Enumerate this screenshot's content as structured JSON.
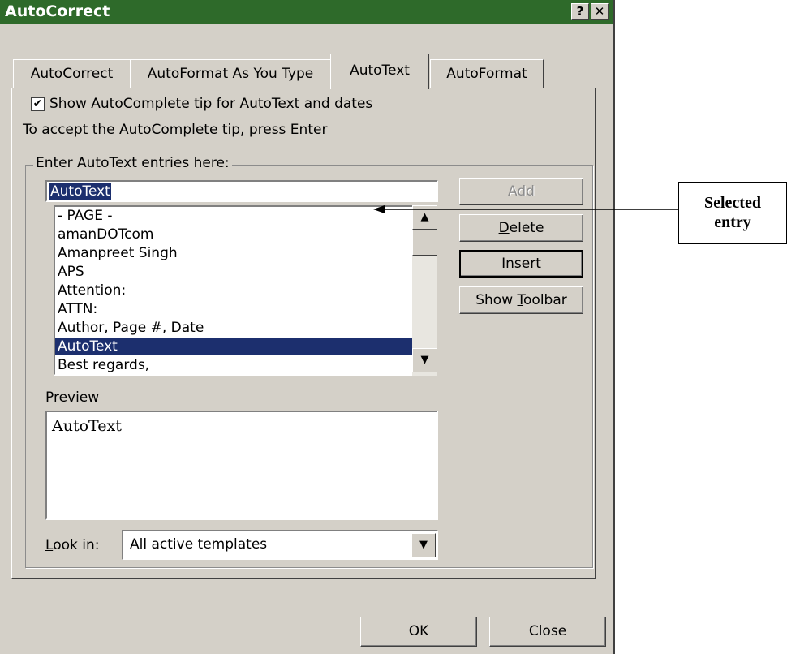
{
  "window": {
    "title": "AutoCorrect",
    "help_btn": "?",
    "close_btn": "✕"
  },
  "tabs": [
    {
      "label": "AutoCorrect"
    },
    {
      "label": "AutoFormat As You Type"
    },
    {
      "label": "AutoText"
    },
    {
      "label": "AutoFormat"
    }
  ],
  "active_tab": "AutoText",
  "options": {
    "show_tip_label": "Show AutoComplete tip for AutoText and dates",
    "show_tip_checked": true,
    "accept_hint": "To accept the AutoComplete tip, press Enter"
  },
  "entry_group": {
    "label": "Enter AutoText entries here:",
    "input_value": "AutoText",
    "items": [
      "- PAGE -",
      "amanDOTcom",
      "Amanpreet Singh",
      "APS",
      "Attention:",
      "ATTN:",
      "Author, Page #, Date",
      "AutoText",
      "Best regards,"
    ],
    "selected_item": "AutoText"
  },
  "buttons": {
    "add": "Add",
    "delete": "Delete",
    "insert": "Insert",
    "show_toolbar": "Show Toolbar",
    "ok": "OK",
    "close": "Close"
  },
  "preview": {
    "label": "Preview",
    "text": "AutoText"
  },
  "look_in": {
    "label": "Look in:",
    "value": "All active templates"
  },
  "annotation": {
    "line1": "Selected",
    "line2": "entry"
  },
  "icons": {
    "scroll_up": "▲",
    "scroll_down": "▼",
    "combo_arrow": "▼",
    "check": "✔"
  },
  "colors": {
    "titlebar": "#2e6a2a",
    "selection": "#1c2f6e",
    "dialog_bg": "#d4d0c8"
  }
}
